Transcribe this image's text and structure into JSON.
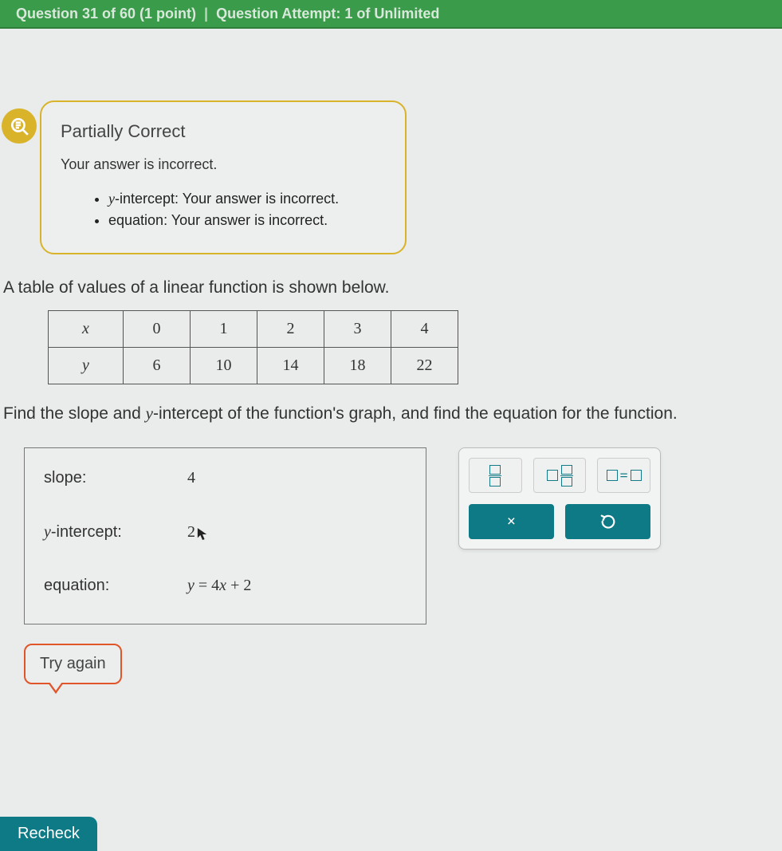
{
  "header": {
    "question_counter": "Question 31 of 60 (1 point)",
    "attempt": "Question Attempt: 1 of Unlimited"
  },
  "feedback": {
    "status_title": "Partially Correct",
    "subtitle": "Your answer is incorrect.",
    "items": [
      {
        "label": "y",
        "suffix": "-intercept: Your answer is incorrect."
      },
      {
        "label": "",
        "suffix": "equation: Your answer is incorrect."
      }
    ]
  },
  "prompt": "A table of values of a linear function is shown below.",
  "table": {
    "row_labels": [
      "x",
      "y"
    ],
    "x_values": [
      "0",
      "1",
      "2",
      "3",
      "4"
    ],
    "y_values": [
      "6",
      "10",
      "14",
      "18",
      "22"
    ]
  },
  "instruction_parts": {
    "p1": "Find the slope and ",
    "yi": "y",
    "p2": "-intercept of the function's graph, and find the equation for the function."
  },
  "answers": {
    "slope_label": "slope:",
    "slope_value": "4",
    "yint_label_prefix": "y",
    "yint_label_suffix": "-intercept:",
    "yint_value": "2",
    "eq_label": "equation:",
    "eq_lhs": "y",
    "eq_mid": " = 4",
    "eq_x": "x",
    "eq_rhs": " + 2"
  },
  "palette": {
    "clear_label": "×",
    "undo_label": "↺"
  },
  "buttons": {
    "try_again": "Try again",
    "recheck": "Recheck"
  }
}
